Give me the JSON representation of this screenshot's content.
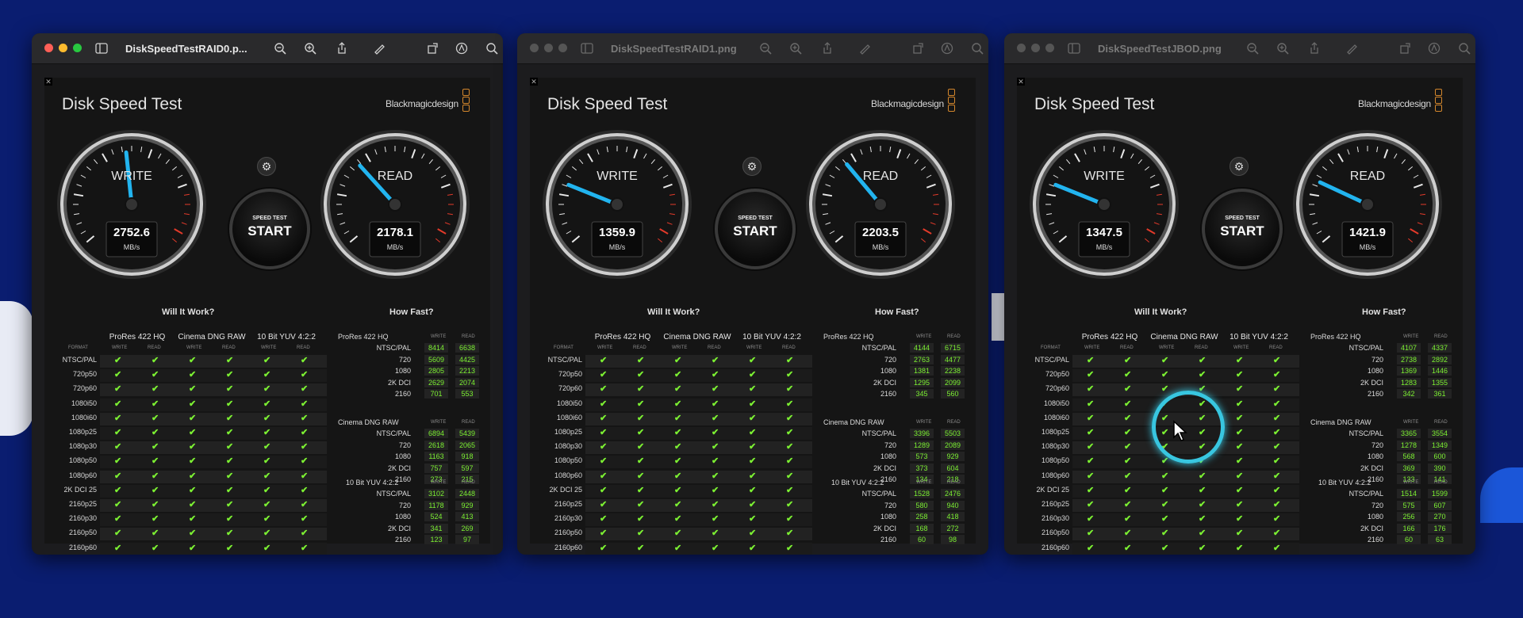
{
  "windows": [
    {
      "file_title": "DiskSpeedTestRAID0.p...",
      "active": true,
      "app_title": "Disk Speed Test",
      "brand": "Blackmagicdesign",
      "write_label": "WRITE",
      "read_label": "READ",
      "write_value": "2752.6",
      "read_value": "2178.1",
      "unit": "MB/s",
      "start_small": "SPEED TEST",
      "start_big": "START",
      "write_needle_angle": -6,
      "read_needle_angle": -42,
      "how_fast": [
        {
          "codec": "ProRes 422 HQ",
          "rows": [
            [
              "NTSC/PAL",
              "8414",
              "6638"
            ],
            [
              "720",
              "5609",
              "4425"
            ],
            [
              "1080",
              "2805",
              "2213"
            ],
            [
              "2K DCI",
              "2629",
              "2074"
            ],
            [
              "2160",
              "701",
              "553"
            ]
          ]
        },
        {
          "codec": "Cinema DNG RAW",
          "rows": [
            [
              "NTSC/PAL",
              "6894",
              "5439"
            ],
            [
              "720",
              "2618",
              "2065"
            ],
            [
              "1080",
              "1163",
              "918"
            ],
            [
              "2K DCI",
              "757",
              "597"
            ],
            [
              "2160",
              "273",
              "215"
            ]
          ]
        },
        {
          "codec": "10 Bit YUV 4:2:2",
          "rows": [
            [
              "NTSC/PAL",
              "3102",
              "2448"
            ],
            [
              "720",
              "1178",
              "929"
            ],
            [
              "1080",
              "524",
              "413"
            ],
            [
              "2K DCI",
              "341",
              "269"
            ],
            [
              "2160",
              "123",
              "97"
            ]
          ]
        }
      ]
    },
    {
      "file_title": "DiskSpeedTestRAID1.png",
      "active": false,
      "app_title": "Disk Speed Test",
      "brand": "Blackmagicdesign",
      "write_label": "WRITE",
      "read_label": "READ",
      "write_value": "1359.9",
      "read_value": "2203.5",
      "unit": "MB/s",
      "start_small": "SPEED TEST",
      "start_big": "START",
      "write_needle_angle": -68,
      "read_needle_angle": -40,
      "how_fast": [
        {
          "codec": "ProRes 422 HQ",
          "rows": [
            [
              "NTSC/PAL",
              "4144",
              "6715"
            ],
            [
              "720",
              "2763",
              "4477"
            ],
            [
              "1080",
              "1381",
              "2238"
            ],
            [
              "2K DCI",
              "1295",
              "2099"
            ],
            [
              "2160",
              "345",
              "560"
            ]
          ]
        },
        {
          "codec": "Cinema DNG RAW",
          "rows": [
            [
              "NTSC/PAL",
              "3396",
              "5503"
            ],
            [
              "720",
              "1289",
              "2089"
            ],
            [
              "1080",
              "573",
              "929"
            ],
            [
              "2K DCI",
              "373",
              "604"
            ],
            [
              "2160",
              "134",
              "218"
            ]
          ]
        },
        {
          "codec": "10 Bit YUV 4:2:2",
          "rows": [
            [
              "NTSC/PAL",
              "1528",
              "2476"
            ],
            [
              "720",
              "580",
              "940"
            ],
            [
              "1080",
              "258",
              "418"
            ],
            [
              "2K DCI",
              "168",
              "272"
            ],
            [
              "2160",
              "60",
              "98"
            ]
          ]
        }
      ]
    },
    {
      "file_title": "DiskSpeedTestJBOD.png",
      "active": false,
      "app_title": "Disk Speed Test",
      "brand": "Blackmagicdesign",
      "write_label": "WRITE",
      "read_label": "READ",
      "write_value": "1347.5",
      "read_value": "1421.9",
      "unit": "MB/s",
      "start_small": "SPEED TEST",
      "start_big": "START",
      "write_needle_angle": -68,
      "read_needle_angle": -65,
      "how_fast": [
        {
          "codec": "ProRes 422 HQ",
          "rows": [
            [
              "NTSC/PAL",
              "4107",
              "4337"
            ],
            [
              "720",
              "2738",
              "2892"
            ],
            [
              "1080",
              "1369",
              "1446"
            ],
            [
              "2K DCI",
              "1283",
              "1355"
            ],
            [
              "2160",
              "342",
              "361"
            ]
          ]
        },
        {
          "codec": "Cinema DNG RAW",
          "rows": [
            [
              "NTSC/PAL",
              "3365",
              "3554"
            ],
            [
              "720",
              "1278",
              "1349"
            ],
            [
              "1080",
              "568",
              "600"
            ],
            [
              "2K DCI",
              "369",
              "390"
            ],
            [
              "2160",
              "133",
              "141"
            ]
          ]
        },
        {
          "codec": "10 Bit YUV 4:2:2",
          "rows": [
            [
              "NTSC/PAL",
              "1514",
              "1599"
            ],
            [
              "720",
              "575",
              "607"
            ],
            [
              "1080",
              "256",
              "270"
            ],
            [
              "2K DCI",
              "166",
              "176"
            ],
            [
              "2160",
              "60",
              "63"
            ]
          ]
        }
      ]
    }
  ],
  "shared": {
    "will_it_work": "Will It Work?",
    "how_fast": "How Fast?",
    "format_label": "FORMAT",
    "write_col": "WRITE",
    "read_col": "READ",
    "groups": [
      "ProRes 422 HQ",
      "Cinema DNG RAW",
      "10 Bit YUV 4:2:2"
    ],
    "formats": [
      "NTSC/PAL",
      "720p50",
      "720p60",
      "1080i50",
      "1080i60",
      "1080p25",
      "1080p30",
      "1080p50",
      "1080p60",
      "2K DCI 25",
      "2160p25",
      "2160p30",
      "2160p50",
      "2160p60"
    ],
    "check_glyph": "✔"
  }
}
